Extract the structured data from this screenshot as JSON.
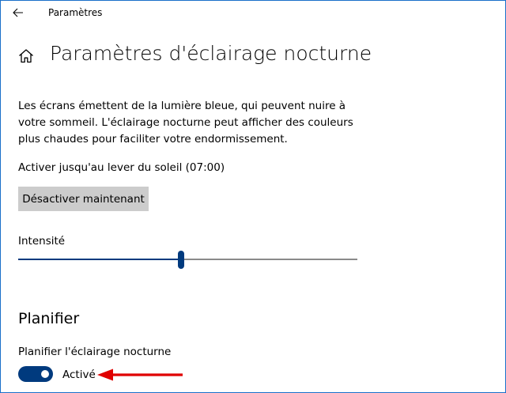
{
  "window": {
    "app_title": "Paramètres"
  },
  "page": {
    "title": "Paramètres d'éclairage nocturne",
    "description": "Les écrans émettent de la lumière bleue, qui peuvent nuire à votre sommeil. L'éclairage nocturne peut afficher des couleurs plus chaudes pour faciliter votre endormissement.",
    "status": "Activer jusqu'au lever du soleil (07:00)",
    "deactivate_button": "Désactiver maintenant"
  },
  "intensity": {
    "label": "Intensité",
    "value_percent": 48
  },
  "schedule": {
    "section_title": "Planifier",
    "toggle_label": "Planifier l'éclairage nocturne",
    "toggle_state": "Activé",
    "toggle_on": true
  },
  "colors": {
    "accent": "#003a7e",
    "annotation_arrow": "#e00000",
    "button_bg": "#cccccc",
    "frame_border": "#1a6fc9"
  },
  "icons": {
    "back": "arrow-left-icon",
    "home": "home-icon"
  }
}
